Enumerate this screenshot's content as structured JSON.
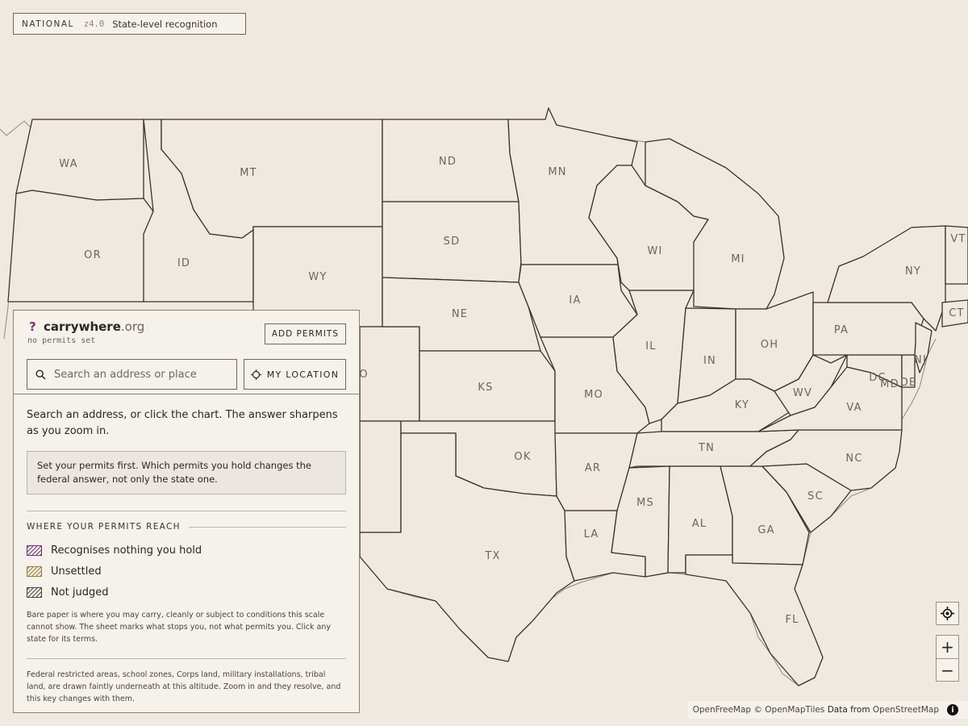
{
  "map": {
    "states": [
      {
        "abbr": "WA"
      },
      {
        "abbr": "OR"
      },
      {
        "abbr": "ID"
      },
      {
        "abbr": "MT"
      },
      {
        "abbr": "WY"
      },
      {
        "abbr": "ND"
      },
      {
        "abbr": "SD"
      },
      {
        "abbr": "NE"
      },
      {
        "abbr": "KS"
      },
      {
        "abbr": "OK"
      },
      {
        "abbr": "TX"
      },
      {
        "abbr": "MN"
      },
      {
        "abbr": "IA"
      },
      {
        "abbr": "MO"
      },
      {
        "abbr": "AR"
      },
      {
        "abbr": "LA"
      },
      {
        "abbr": "WI"
      },
      {
        "abbr": "IL"
      },
      {
        "abbr": "MI"
      },
      {
        "abbr": "IN"
      },
      {
        "abbr": "OH"
      },
      {
        "abbr": "KY"
      },
      {
        "abbr": "TN"
      },
      {
        "abbr": "MS"
      },
      {
        "abbr": "AL"
      },
      {
        "abbr": "GA"
      },
      {
        "abbr": "FL"
      },
      {
        "abbr": "SC"
      },
      {
        "abbr": "NC"
      },
      {
        "abbr": "VA"
      },
      {
        "abbr": "WV"
      },
      {
        "abbr": "PA"
      },
      {
        "abbr": "NY"
      },
      {
        "abbr": "MD"
      },
      {
        "abbr": "DC"
      },
      {
        "abbr": "DE"
      },
      {
        "abbr": "NJ"
      },
      {
        "abbr": "CT"
      },
      {
        "abbr": "VT"
      },
      {
        "abbr": "CO"
      }
    ]
  },
  "zoom_tag": {
    "scope": "NATIONAL",
    "level": "z4.0",
    "description": "State-level recognition"
  },
  "panel": {
    "brand_mark": "?",
    "brand_name": "carrywhere",
    "brand_tld": ".org",
    "permits_status": "no permits set",
    "add_permits_label": "ADD PERMITS",
    "search_placeholder": "Search an address or place",
    "my_location_label": "MY LOCATION",
    "intro": "Search an address, or click the chart. The answer sharpens as you zoom in.",
    "notice": "Set your permits first. Which permits you hold changes the federal answer, not only the state one.",
    "section_title": "WHERE YOUR PERMITS REACH",
    "legend": [
      {
        "label": "Recognises nothing you hold",
        "color": "#7a2a7a"
      },
      {
        "label": "Unsettled",
        "color": "#a07a1a"
      },
      {
        "label": "Not judged",
        "color": "#4a443c"
      }
    ],
    "note1": "Bare paper is where you may carry, cleanly or subject to conditions this scale cannot show. The sheet marks what stops you, not what permits you. Click any state for its terms.",
    "note2": "Federal restricted areas, school zones, Corps land, military installations, tribal land, are drawn faintly underneath at this altitude. Zoom in and they resolve, and this key changes with them."
  },
  "controls": {
    "zoom_in": "+",
    "zoom_out": "−"
  },
  "attribution": {
    "openfreemap": "OpenFreeMap",
    "copyright": "©",
    "openmaptiles": "OpenMapTiles",
    "data_from": "Data from",
    "osm": "OpenStreetMap",
    "info": "i"
  },
  "colors": {
    "paper": "#f0e9df",
    "accent": "#8a2f6e"
  }
}
